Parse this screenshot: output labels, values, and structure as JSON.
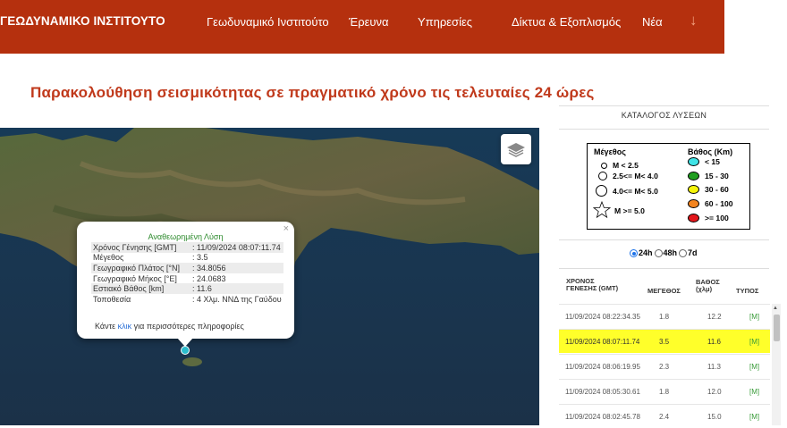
{
  "nav": {
    "brand": "ΓΕΩΔΥΝΑΜΙΚΟ ΙΝΣΤΙΤΟΥΤΟ",
    "links": [
      "Γεωδυναμικό Ινστιτούτο",
      "Έρευνα",
      "Υπηρεσίες",
      "Δίκτυα & Εξοπλισμός",
      "Νέα"
    ],
    "more_icon": "↓"
  },
  "headline": "Παρακολούθηση σεισμικότητας σε πραγματικό χρόνο τις τελευταίες 24 ώρες",
  "popup": {
    "title": "Αναθεωρημένη Λύση",
    "rows": [
      {
        "label": "Χρόνος Γένησης [GMT]",
        "value": ": 11/09/2024 08:07:11.74"
      },
      {
        "label": "Μέγεθος",
        "value": ": 3.5"
      },
      {
        "label": "Γεωγραφικό Πλάτος [°N]",
        "value": ": 34.8056"
      },
      {
        "label": "Γεωγραφικό Μήκος [°E]",
        "value": ": 24.0683"
      },
      {
        "label": "Εστιακό Βάθος [km]",
        "value": ": 11.6"
      },
      {
        "label": "Τοποθεσία",
        "value": ": 4 Χλμ. ΝΝΔ της Γαύδου"
      }
    ],
    "more_prefix": "Κάντε ",
    "more_link": "κλικ",
    "more_suffix": " για περισσότερες πληροφορίες",
    "close": "×"
  },
  "panel": {
    "title": "ΚΑΤΑΛΟΓΟΣ ΛΥΣΕΩΝ",
    "legend": {
      "mag_header": "Μέγεθος",
      "depth_header": "Βάθος (Km)",
      "mags": [
        "M < 2.5",
        "2.5<= M< 4.0",
        "4.0<= M< 5.0",
        "M >= 5.0"
      ],
      "depths": [
        {
          "label": "< 15",
          "color": "#3fe3e6"
        },
        {
          "label": "15 - 30",
          "color": "#1f9e1f"
        },
        {
          "label": "30 - 60",
          "color": "#f5f50a"
        },
        {
          "label": "60 - 100",
          "color": "#f3841e"
        },
        {
          "label": ">= 100",
          "color": "#e3161b"
        }
      ]
    },
    "periods": [
      {
        "label": "24h",
        "checked": true
      },
      {
        "label": "48h",
        "checked": false
      },
      {
        "label": "7d",
        "checked": false
      }
    ],
    "columns": [
      "ΧΡΟΝΟΣ\nΓΕΝΕΣΗΣ (GMT)",
      "ΜΕΓΕΘΟΣ",
      "ΒΑΘΟΣ\n(χλμ)",
      "ΤΥΠΟΣ"
    ],
    "col_time_1": "ΧΡΟΝΟΣ",
    "col_time_2": "ΓΕΝΕΣΗΣ (GMT)",
    "col_mag": "ΜΕΓΕΘΟΣ",
    "col_depth_1": "ΒΑΘΟΣ",
    "col_depth_2": "(χλμ)",
    "col_type": "ΤΥΠΟΣ",
    "events": [
      {
        "time": "11/09/2024 08:22:34.35",
        "mag": "1.8",
        "depth": "12.2",
        "type": "[M]",
        "highlighted": false
      },
      {
        "time": "11/09/2024 08:07:11.74",
        "mag": "3.5",
        "depth": "11.6",
        "type": "[M]",
        "highlighted": true
      },
      {
        "time": "11/09/2024 08:06:19.95",
        "mag": "2.3",
        "depth": "11.3",
        "type": "[M]",
        "highlighted": false
      },
      {
        "time": "11/09/2024 08:05:30.61",
        "mag": "1.8",
        "depth": "12.0",
        "type": "[M]",
        "highlighted": false
      },
      {
        "time": "11/09/2024 08:02:45.78",
        "mag": "2.4",
        "depth": "15.0",
        "type": "[M]",
        "highlighted": false
      }
    ]
  },
  "colors": {
    "nav_bg": "#b5300e",
    "headline": "#c0391b",
    "highlight": "#ffff2a",
    "marker": "#2bbccd"
  }
}
